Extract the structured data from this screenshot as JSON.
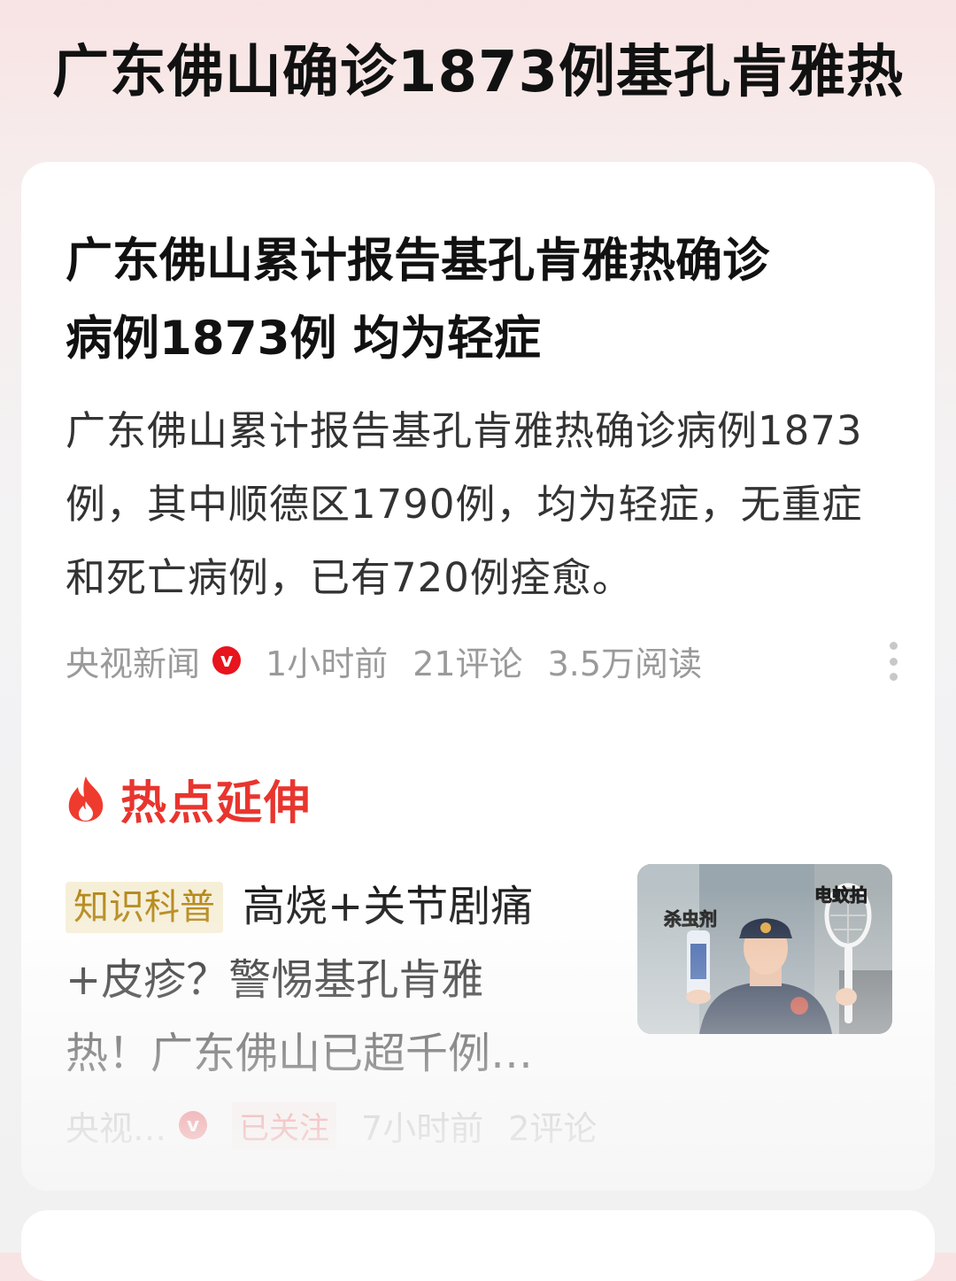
{
  "page": {
    "title": "广东佛山确诊1873例基孔肯雅热"
  },
  "article": {
    "headline_line1": "广东佛山累计报告基孔肯雅热确诊",
    "headline_line2": "病例1873例 均为轻症",
    "summary": "广东佛山累计报告基孔肯雅热确诊病例1873例，其中顺德区1790例，均为轻症，无重症和死亡病例，已有720例痊愈。",
    "meta": {
      "source": "央视新闻",
      "verified_badge": "v",
      "time": "1小时前",
      "comments": "21评论",
      "reads": "3.5万阅读"
    }
  },
  "hot_section": {
    "title": "热点延伸",
    "icon": "flame-icon"
  },
  "related": {
    "tag": "知识科普",
    "title_line1": "高烧+关节剧痛",
    "title_line2": "+皮疹？警惕基孔肯雅",
    "title_line3": "热！广东佛山已超千例…",
    "thumb_label_left": "杀虫剂",
    "thumb_label_right": "电蚊拍",
    "meta": {
      "source": "央视…",
      "verified_badge": "v",
      "follow": "已关注",
      "time": "7小时前",
      "comments": "2评论"
    }
  },
  "colors": {
    "accent_red": "#e8352e",
    "tag_gold": "#b58718",
    "meta_gray": "#9a9a9a"
  }
}
